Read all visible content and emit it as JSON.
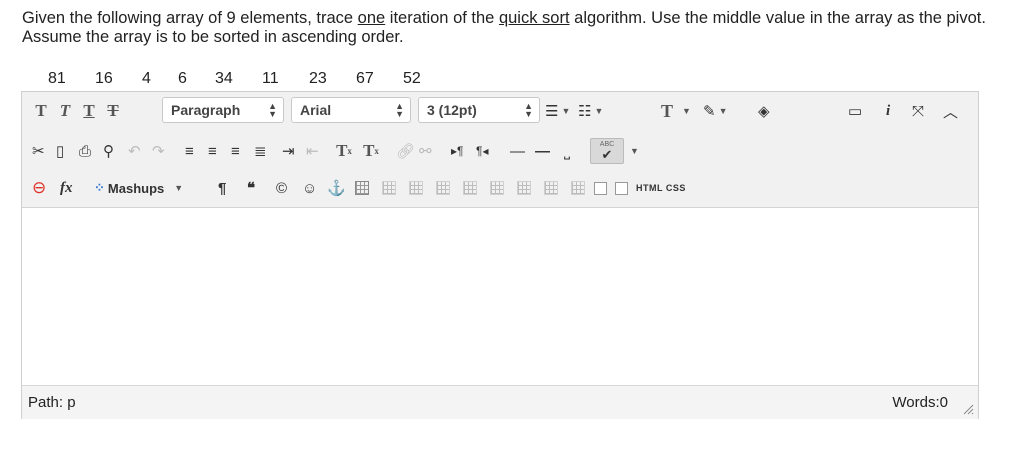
{
  "question": {
    "part1": "Given the following array of 9 elements, trace ",
    "part2": "one",
    "part3": " iteration of the ",
    "part4": "quick sort",
    "part5": " algorithm. Use the middle value in the array as the pivot.  Assume the array is to be sorted in ascending order."
  },
  "array": [
    "81",
    "16",
    "4",
    "6",
    "34",
    "11",
    "23",
    "67",
    "52"
  ],
  "toolbar": {
    "format_buttons": [
      "T",
      "T",
      "T",
      "T"
    ],
    "paragraph_select": "Paragraph",
    "font_select": "Arial",
    "size_select": "3 (12pt)",
    "superscript": "T",
    "subscript": "T",
    "mashups": "Mashups",
    "html_css": "HTML CSS",
    "spellcheck": "ABC",
    "info": "i",
    "fx": "fx"
  },
  "status": {
    "path": "Path: p",
    "words": "Words:0"
  }
}
